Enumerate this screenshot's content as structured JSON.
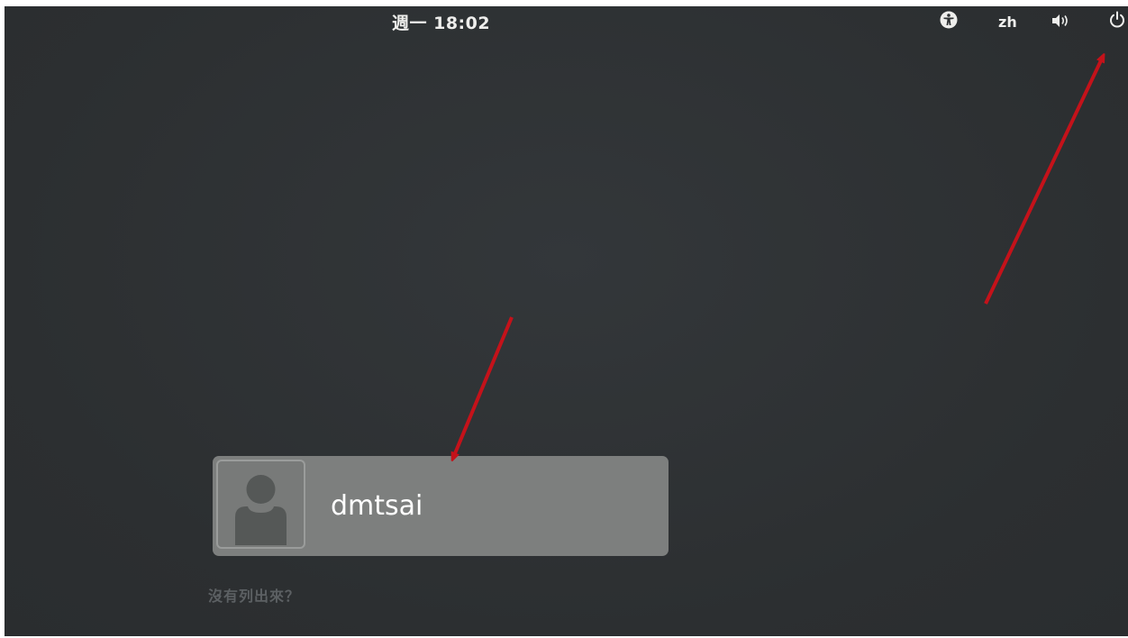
{
  "topbar": {
    "clock": "週一 18:02",
    "language": "zh",
    "icons": [
      "accessibility-icon",
      "volume-icon",
      "power-icon"
    ]
  },
  "login": {
    "user": {
      "name": "dmtsai",
      "avatar": "default-user-avatar"
    },
    "not_listed": "沒有列出來？"
  },
  "colors": {
    "background": "#2e3133",
    "card": "#7d7f7e",
    "annotation_arrow": "#c4121a"
  }
}
